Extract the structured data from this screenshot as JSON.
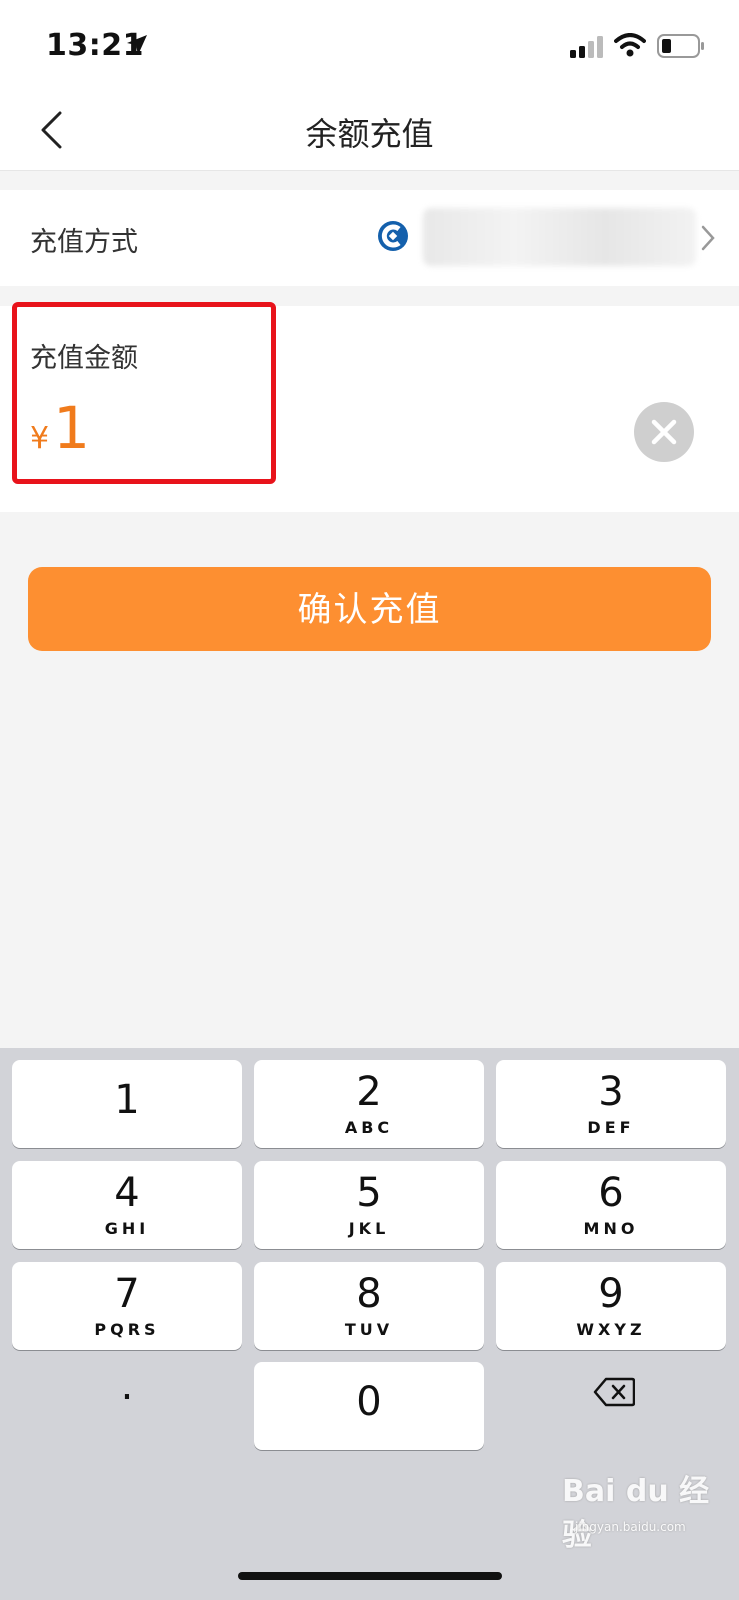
{
  "status_bar": {
    "time": "13:21"
  },
  "nav": {
    "title": "余额充值"
  },
  "method": {
    "label": "充值方式",
    "bank_name": ""
  },
  "amount": {
    "label": "充值金额",
    "currency": "¥",
    "value": "1"
  },
  "confirm": {
    "label": "确认充值"
  },
  "keyboard": {
    "keys": [
      {
        "digit": "1",
        "letters": ""
      },
      {
        "digit": "2",
        "letters": "ABC"
      },
      {
        "digit": "3",
        "letters": "DEF"
      },
      {
        "digit": "4",
        "letters": "GHI"
      },
      {
        "digit": "5",
        "letters": "JKL"
      },
      {
        "digit": "6",
        "letters": "MNO"
      },
      {
        "digit": "7",
        "letters": "PQRS"
      },
      {
        "digit": "8",
        "letters": "TUV"
      },
      {
        "digit": "9",
        "letters": "WXYZ"
      },
      {
        "digit": "0",
        "letters": ""
      }
    ],
    "dot": "."
  },
  "watermark": {
    "brand": "Bai du 经验",
    "url": "jingyan.baidu.com"
  },
  "colors": {
    "accent": "#fd8f31",
    "amount": "#f07b1c",
    "highlight": "#e8131b",
    "bank": "#1460ac"
  }
}
